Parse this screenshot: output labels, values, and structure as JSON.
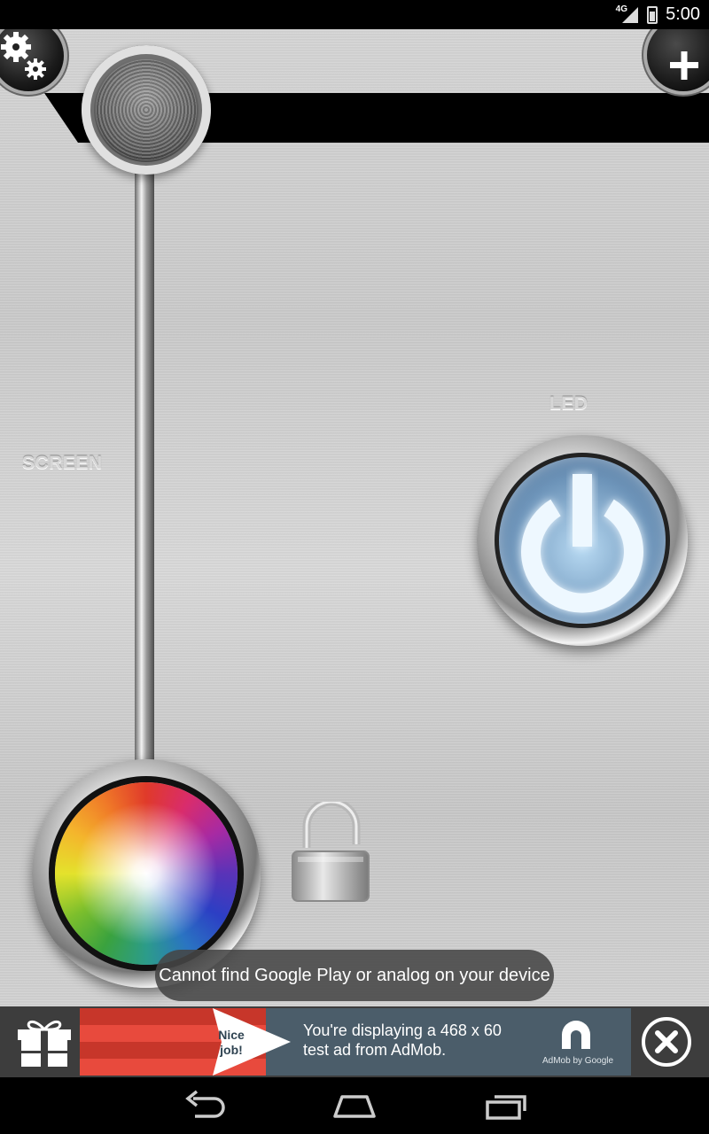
{
  "status_bar": {
    "network_label": "4G",
    "time": "5:00"
  },
  "controls": {
    "screen_label": "SCREEN",
    "led_label": "LED"
  },
  "toast": {
    "message": "Cannot find Google Play or analog on your device"
  },
  "ad": {
    "badge_line1": "Nice",
    "badge_line2": "job!",
    "text_line1": "You're displaying a 468 x 60",
    "text_line2": "test ad from AdMob.",
    "brand": "AdMob by Google"
  },
  "icons": {
    "settings": "gears-icon",
    "add": "plus-icon",
    "power": "power-icon",
    "lock": "unlocked-padlock-icon",
    "gift": "gift-icon",
    "close": "close-icon",
    "back": "back-icon",
    "home": "home-icon",
    "recents": "recents-icon"
  },
  "colors": {
    "led_glow": "#d9f0ff",
    "toast_bg": "#464646",
    "ad_panel": "#4b5d6a",
    "ad_red": "#e84a3d"
  }
}
